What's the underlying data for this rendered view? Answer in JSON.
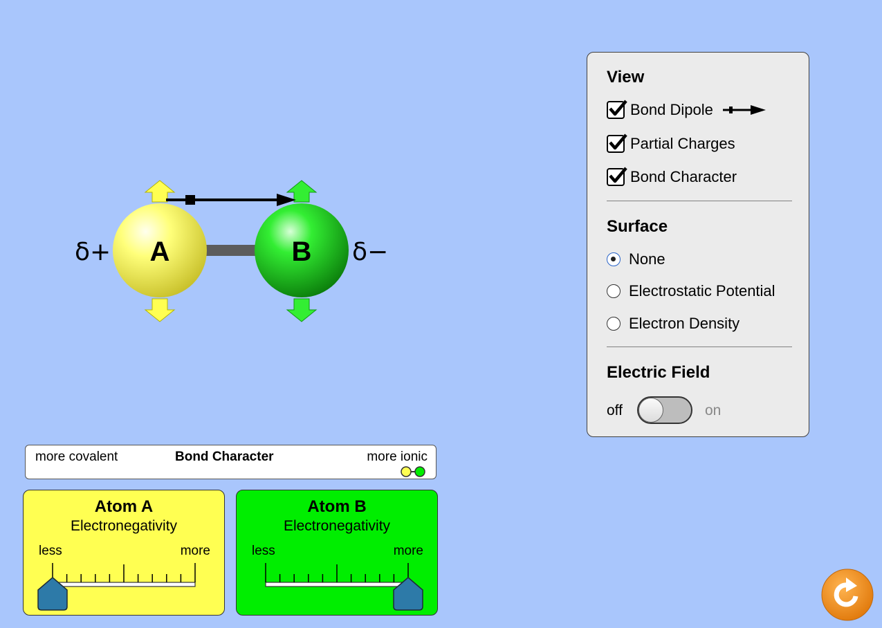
{
  "molecule": {
    "atom_a_label": "A",
    "atom_b_label": "B",
    "atom_a_partial_charge": "δ+",
    "atom_b_partial_charge": "δ−"
  },
  "view_panel": {
    "view_title": "View",
    "checkboxes": [
      {
        "label": "Bond Dipole",
        "checked": true
      },
      {
        "label": "Partial Charges",
        "checked": true
      },
      {
        "label": "Bond Character",
        "checked": true
      }
    ],
    "surface_title": "Surface",
    "surface_options": [
      {
        "label": "None",
        "selected": true
      },
      {
        "label": "Electrostatic Potential",
        "selected": false
      },
      {
        "label": "Electron Density",
        "selected": false
      }
    ],
    "electric_field_title": "Electric Field",
    "toggle_off_label": "off",
    "toggle_on_label": "on",
    "electric_field_on": false
  },
  "bond_character": {
    "title": "Bond Character",
    "left_label": "more covalent",
    "right_label": "more ionic"
  },
  "atom_a_panel": {
    "title": "Atom A",
    "subtitle": "Electronegativity",
    "less_label": "less",
    "more_label": "more",
    "slider_value_fraction": 0.0,
    "color": "#ffff52"
  },
  "atom_b_panel": {
    "title": "Atom B",
    "subtitle": "Electronegativity",
    "less_label": "less",
    "more_label": "more",
    "slider_value_fraction": 1.0,
    "color": "#00ee00"
  },
  "colors": {
    "background": "#a9c6fc",
    "atom_a": "#ffff52",
    "atom_b": "#00ee00",
    "reset_button": "#f39420"
  },
  "icons": {
    "reset": "reset-arrow-icon",
    "checkbox": "checkmark-icon",
    "dipole": "dipole-arrow-icon"
  }
}
